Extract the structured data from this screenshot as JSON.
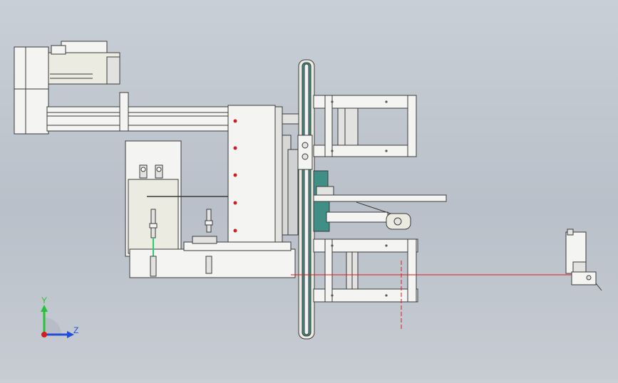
{
  "viewport": {
    "background_top": "#c9cfd6",
    "background_bottom": "#bcc2cb"
  },
  "model": {
    "part_fill": "#f4f4f2",
    "part_stroke": "#3a3a3a",
    "shaded_fill": "#e2e2e0",
    "beige_fill": "#ecebe2",
    "accent_teal": "#3f8f86",
    "red_dot": "#cc1f1f",
    "laser_color": "#e01a1a",
    "green_trace": "#2ecc71"
  },
  "triad": {
    "y_label": "Y",
    "z_label": "Z",
    "y_color": "#27c23a",
    "z_color": "#1f4fd6",
    "x_color": "#d31c1c"
  }
}
